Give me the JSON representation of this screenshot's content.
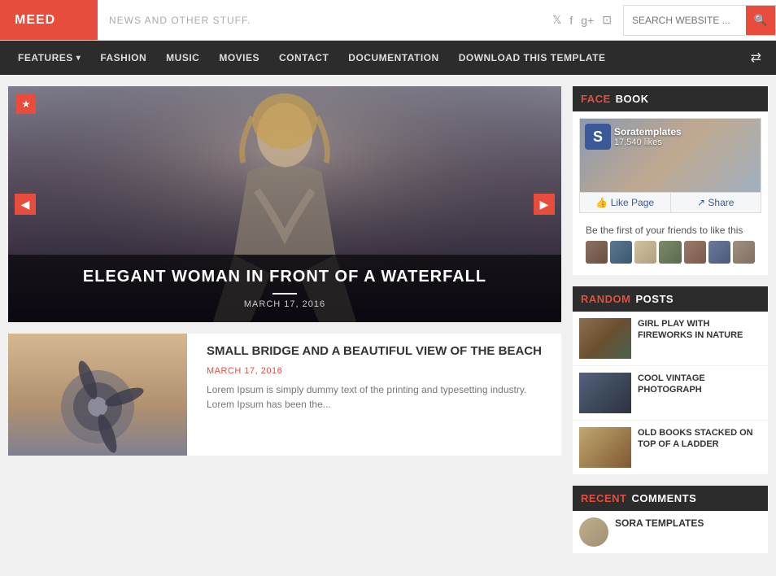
{
  "header": {
    "logo": "MEED",
    "tagline": "NEWS AND OTHER STUFF.",
    "search_placeholder": "SEARCH WEBSITE ...",
    "social": [
      "twitter",
      "facebook",
      "google-plus",
      "instagram"
    ]
  },
  "nav": {
    "items": [
      {
        "label": "FEATURES",
        "has_dropdown": true
      },
      {
        "label": "FASHION"
      },
      {
        "label": "MUSIC"
      },
      {
        "label": "MOVIES"
      },
      {
        "label": "CONTACT"
      },
      {
        "label": "DOCUMENTATION"
      },
      {
        "label": "DOWNLOAD THIS TEMPLATE"
      }
    ]
  },
  "featured": {
    "title": "ELEGANT WOMAN IN FRONT OF A WATERFALL",
    "date": "MARCH 17, 2016"
  },
  "article1": {
    "title": "SMALL BRIDGE AND A BEAUTIFUL VIEW OF THE BEACH",
    "date": "MARCH 17, 2016",
    "excerpt": "Lorem Ipsum is simply dummy text of the printing and typesetting industry. Lorem Ipsum has been the..."
  },
  "sidebar": {
    "facebook": {
      "section_accent": "FACE",
      "section_title": "BOOK",
      "page_name": "Soratemplates",
      "page_likes": "17,540 likes",
      "friends_text": "Be the first of your friends to like this",
      "like_btn": "👍 Like Page",
      "share_btn": "↗ Share"
    },
    "random_posts": {
      "section_accent": "RANDOM",
      "section_title": "POSTS",
      "posts": [
        {
          "title": "GIRL PLAY WITH FIREWORKS IN NATURE"
        },
        {
          "title": "COOL VINTAGE PHOTOGRAPH"
        },
        {
          "title": "OLD BOOKS STACKED ON TOP OF A LADDER"
        }
      ]
    },
    "recent_comments": {
      "section_accent": "RECENT",
      "section_title": "COMMENTS",
      "commenter": "SORA TEMPLATES"
    }
  }
}
